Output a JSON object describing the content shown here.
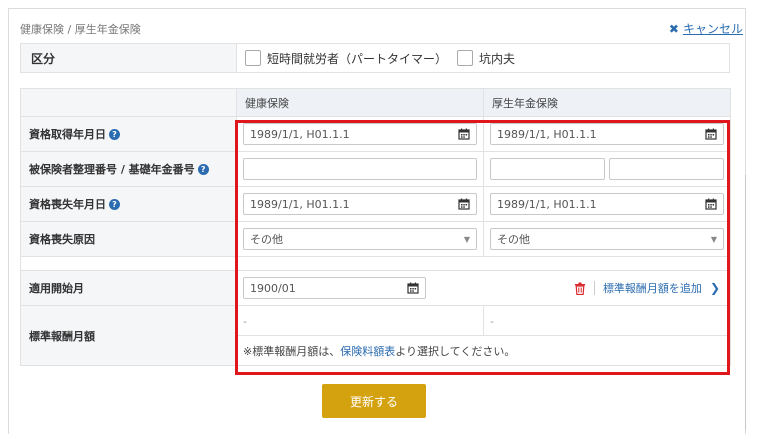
{
  "section": {
    "title": "健康保険 / 厚生年金保険"
  },
  "cancel": {
    "icon": "close-icon",
    "label": "キャンセル"
  },
  "category": {
    "label": "区分",
    "options": [
      "短時間就労者（パートタイマー）",
      "坑内夫"
    ]
  },
  "table": {
    "col_health": "健康保険",
    "col_pension": "厚生年金保険",
    "rows": {
      "acquire": {
        "label": "資格取得年月日",
        "health_value": "1989/1/1, H01.1.1",
        "pension_value": "1989/1/1, H01.1.1"
      },
      "insured_no": {
        "label": "被保険者整理番号 / 基礎年金番号"
      },
      "loss_date": {
        "label": "資格喪失年月日",
        "health_value": "1989/1/1, H01.1.1",
        "pension_value": "1989/1/1, H01.1.1"
      },
      "loss_reason": {
        "label": "資格喪失原因",
        "health_value": "その他",
        "pension_value": "その他"
      },
      "apply_month": {
        "label": "適用開始月",
        "value": "1900/01",
        "add_label": "標準報酬月額を追加"
      },
      "std_salary": {
        "label": "標準報酬月額",
        "health_value": "-",
        "pension_value": "-"
      }
    },
    "note_prefix": "※標準報酬月額は、",
    "note_link": "保険料額表",
    "note_suffix": "より選択してください。",
    "help_glyph": "?"
  },
  "update_button": {
    "label": "更新する"
  },
  "colors": {
    "accent": "#2b6cb0",
    "highlight": "#e0161d",
    "button": "#d4a20f"
  }
}
